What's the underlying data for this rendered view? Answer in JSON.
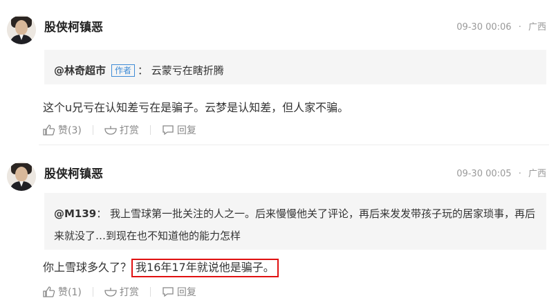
{
  "comments": [
    {
      "username": "股侠柯镇恶",
      "time": "09-30 00:06",
      "location": "广西",
      "quote_mention": "@林奇超市",
      "quote_tag": "作者",
      "quote_text": "：  云蒙亏在瞎折腾",
      "body": "这个u兄亏在认知差亏在是骗子。云梦是认知差，但人家不骗。",
      "like_label": "赞(3)",
      "reward_label": "打赏",
      "reply_label": "回复"
    },
    {
      "username": "股侠柯镇恶",
      "time": "09-30 00:05",
      "location": "广西",
      "quote_mention": "@M139",
      "quote_text": "：  我上雪球第一批关注的人之一。后来慢慢他关了评论，再后来发发带孩子玩的居家琐事，再后来就没了…到现在也不知道他的能力怎样",
      "body_before": "你上雪球多久了？",
      "body_highlight": "我16年17年就说他是骗子。",
      "like_label": "赞(1)",
      "reward_label": "打赏",
      "reply_label": "回复"
    }
  ],
  "colors": {
    "highlight_border": "#e01010",
    "author_tag": "#3d8bd6"
  }
}
